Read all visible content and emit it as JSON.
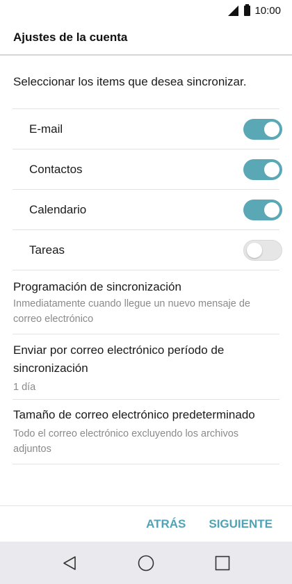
{
  "status_bar": {
    "time": "10:00"
  },
  "header": {
    "title": "Ajustes de la cuenta"
  },
  "intro": "Seleccionar los items que desea sincronizar.",
  "sync_items": [
    {
      "label": "E-mail",
      "enabled": true
    },
    {
      "label": "Contactos",
      "enabled": true
    },
    {
      "label": "Calendario",
      "enabled": true
    },
    {
      "label": "Tareas",
      "enabled": false
    }
  ],
  "settings": [
    {
      "title": "Programación de sincronización",
      "subtitle": "Inmediatamente cuando llegue un nuevo mensaje de correo electrónico"
    },
    {
      "title": "Enviar por correo electrónico período de sincronización",
      "subtitle": "1 día"
    },
    {
      "title": "Tamaño de correo electrónico predeterminado",
      "subtitle": "Todo el correo electrónico excluyendo los archivos adjuntos"
    }
  ],
  "actions": {
    "back_label": "ATRÁS",
    "next_label": "SIGUIENTE"
  },
  "colors": {
    "accent": "#4fa3b5",
    "switch_on": "#5aa7b5",
    "switch_off": "#e6e6e6"
  },
  "icons": {
    "nav_back": "triangle-back-icon",
    "nav_home": "circle-home-icon",
    "nav_recents": "square-recents-icon"
  }
}
